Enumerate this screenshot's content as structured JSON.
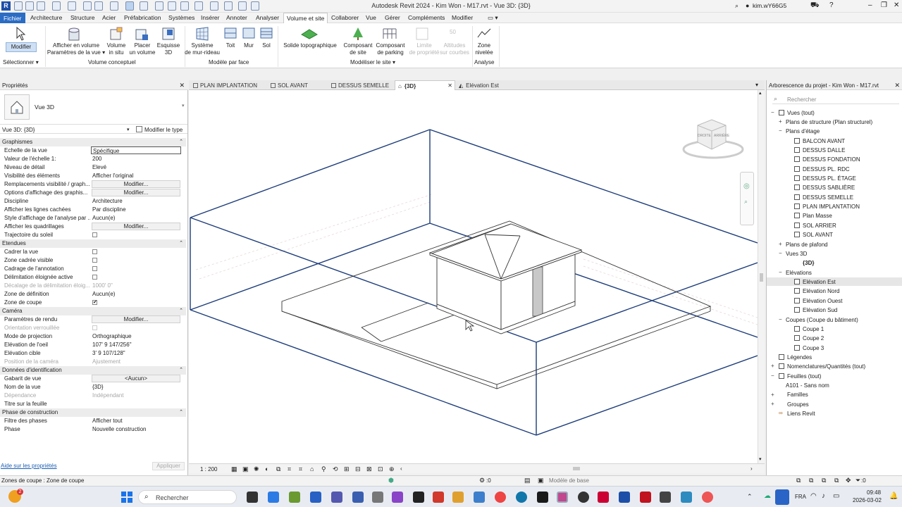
{
  "app": {
    "title": "Autodesk Revit 2024 - Kim Won - M17.rvt - Vue 3D: {3D}",
    "user": "kim.wY66G5",
    "logo": "R"
  },
  "menu": [
    "Fichier",
    "Architecture",
    "Structure",
    "Acier",
    "Préfabrication",
    "Systèmes",
    "Insérer",
    "Annoter",
    "Analyser",
    "Volume et site",
    "Collaborer",
    "Vue",
    "Gérer",
    "Compléments",
    "Modifier"
  ],
  "ribbon": {
    "modifier": "Modifier",
    "selectionner": "Sélectionner",
    "afficher_volume_1": "Afficher en volume",
    "afficher_volume_2": "Paramètres de la vue",
    "volume_in_situ_1": "Volume",
    "volume_in_situ_2": "in situ",
    "placer_volume_1": "Placer",
    "placer_volume_2": "un volume",
    "esquisse_1": "Esquisse",
    "esquisse_2": "3D",
    "panel_volume": "Volume conceptuel",
    "systeme_1": "Système",
    "systeme_2": "de mur-rideau",
    "toit": "Toit",
    "mur": "Mur",
    "sol": "Sol",
    "panel_modele": "Modèle par face",
    "solide_topo": "Solide topographique",
    "composant_site_1": "Composant",
    "composant_site_2": "de site",
    "composant_parking_1": "Composant",
    "composant_parking_2": "de parking",
    "limite_1": "Limite",
    "limite_2": "de propriété",
    "altitudes_1": "Altitudes",
    "altitudes_2": "sur courbes",
    "panel_site": "Modéliser le site",
    "zone_1": "Zone",
    "zone_2": "nivelée",
    "panel_analyse": "Analyse"
  },
  "properties": {
    "panel_title": "Propriétés",
    "type_name": "Vue 3D",
    "selector": "Vue 3D: {3D}",
    "edit_type": "Modifier le type",
    "sections": {
      "graphismes": "Graphismes",
      "etendues": "Etendues",
      "camera": "Caméra",
      "donnees": "Données d'identification",
      "phase": "Phase de construction"
    },
    "rows": {
      "echelle_k": "Echelle de la vue",
      "echelle_v": "Spécifique",
      "valeur_k": "Valeur de l'échelle    1:",
      "valeur_v": "200",
      "niveau_k": "Niveau de détail",
      "niveau_v": "Elevé",
      "visib_k": "Visibilité des éléments",
      "visib_v": "Afficher l'original",
      "rempl_k": "Remplacements visibilité / graph...",
      "options_k": "Options d'affichage des graphis...",
      "discipline_k": "Discipline",
      "discipline_v": "Architecture",
      "lignes_k": "Afficher les lignes cachées",
      "lignes_v": "Par discipline",
      "style_k": "Style d'affichage de l'analyse par ...",
      "style_v": "Aucun(e)",
      "quad_k": "Afficher les quadrillages",
      "traj_k": "Trajectoire du soleil",
      "cadrer_k": "Cadrer la vue",
      "zonecadree_k": "Zone cadrée visible",
      "cadrage_k": "Cadrage de l'annotation",
      "delim_k": "Délimitation éloignée active",
      "decal_k": "Décalage de la délimitation éloig...",
      "decal_v": "1000'  0\"",
      "zonedef_k": "Zone de définition",
      "zonedef_v": "Aucun(e)",
      "zonecoupe_k": "Zone de coupe",
      "rendu_k": "Paramètres de rendu",
      "orient_k": "Orientation verrouillée",
      "mode_k": "Mode de projection",
      "mode_v": "Orthographique",
      "elev_oeil_k": "Elévation de l'oeil",
      "elev_oeil_v": "107'  9 147/256\"",
      "elev_cible_k": "Elévation cible",
      "elev_cible_v": "3'  9 107/128\"",
      "pos_cam_k": "Position de la caméra",
      "pos_cam_v": "Ajustement",
      "gabarit_k": "Gabarit de vue",
      "gabarit_v": "<Aucun>",
      "nom_k": "Nom de la vue",
      "nom_v": "{3D}",
      "dep_k": "Dépendance",
      "dep_v": "Indépendant",
      "titre_k": "Titre sur la feuille",
      "filtre_k": "Filtre des phases",
      "filtre_v": "Afficher tout",
      "phase_k": "Phase",
      "phase_v": "Nouvelle construction"
    },
    "modify_btn": "Modifier...",
    "help_link": "Aide sur les propriétés",
    "apply": "Appliquer"
  },
  "tabs": [
    "PLAN IMPLANTATION",
    "SOL AVANT",
    "DESSUS SEMELLE",
    "{3D}",
    "Elévation Est"
  ],
  "view": {
    "scale": "1 : 200",
    "cube_front": "DROITE",
    "cube_right": "ARRIÈRE"
  },
  "browser": {
    "title": "Arborescence du projet - Kim Won - M17.rvt",
    "search_placeholder": "Rechercher",
    "items": [
      "Vues (tout)",
      "Plans de structure (Plan structurel)",
      "Plans d'étage",
      "BALCON AVANT",
      "DESSUS DALLE",
      "DESSUS FONDATION",
      "DESSUS PL. RDC",
      "DESSUS PL. ÉTAGE",
      "DESSUS SABLIÈRE",
      "DESSUS SEMELLE",
      "PLAN IMPLANTATION",
      "Plan Masse",
      "SOL ARRIER",
      "SOL AVANT",
      "Plans de plafond",
      "Vues 3D",
      "{3D}",
      "Elévations",
      "Elévation Est",
      "Elévation Nord",
      "Elévation Ouest",
      "Elévation Sud",
      "Coupes (Coupe du bâtiment)",
      "Coupe 1",
      "Coupe 2",
      "Coupe 3",
      "Légendes",
      "Nomenclatures/Quantités (tout)",
      "Feuilles (tout)",
      "A101 - Sans nom",
      "Familles",
      "Groupes",
      "Liens Revit"
    ]
  },
  "status": {
    "left": "Zones de coupe : Zone de coupe",
    "zero": ":0",
    "model": "Modèle de base",
    "filter": ":0"
  },
  "taskbar": {
    "search": "Rechercher",
    "lang": "FRA",
    "time": "09:48",
    "date": "2026-03-02",
    "notif_count": "2"
  }
}
